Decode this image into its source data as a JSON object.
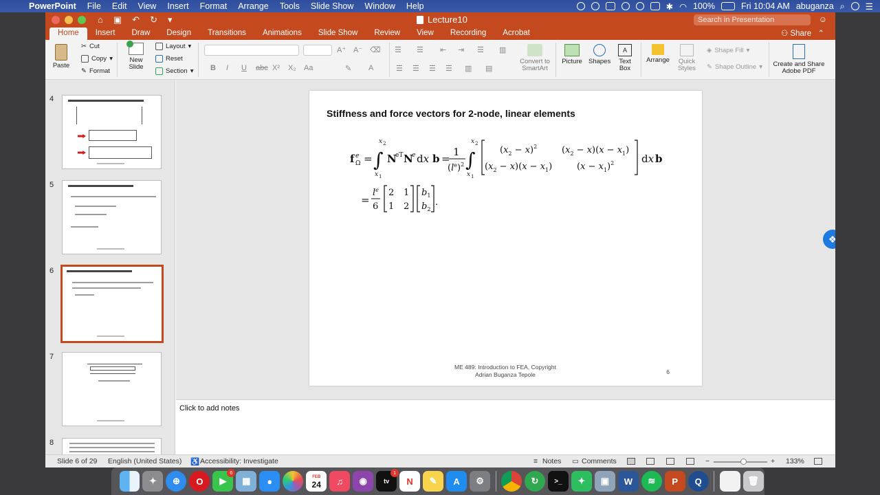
{
  "menubar": {
    "app": "PowerPoint",
    "items": [
      "File",
      "Edit",
      "View",
      "Insert",
      "Format",
      "Arrange",
      "Tools",
      "Slide Show",
      "Window",
      "Help"
    ],
    "battery": "100%",
    "clock": "Fri 10:04 AM",
    "user": "abuganza"
  },
  "window": {
    "title": "Lecture10",
    "search_placeholder": "Search in Presentation"
  },
  "tabs": [
    "Home",
    "Insert",
    "Draw",
    "Design",
    "Transitions",
    "Animations",
    "Slide Show",
    "Review",
    "View",
    "Recording",
    "Acrobat"
  ],
  "share_label": "Share",
  "ribbon": {
    "paste": "Paste",
    "cut": "Cut",
    "copy": "Copy",
    "format": "Format",
    "new_slide_1": "New",
    "new_slide_2": "Slide",
    "layout": "Layout",
    "reset": "Reset",
    "section": "Section",
    "convert_1": "Convert to",
    "convert_2": "SmartArt",
    "picture": "Picture",
    "shapes": "Shapes",
    "textbox_1": "Text",
    "textbox_2": "Box",
    "arrange": "Arrange",
    "quick_1": "Quick",
    "quick_2": "Styles",
    "shape_fill": "Shape Fill",
    "shape_outline": "Shape Outline",
    "adobe_1": "Create and Share",
    "adobe_2": "Adobe PDF"
  },
  "thumbnails": [
    {
      "num": "4",
      "title": "Plug into the weak form leads to the stiffness matrix and force vectors"
    },
    {
      "num": "5",
      "title": "Stiffness and force vectors for 2-node, linear elements"
    },
    {
      "num": "6",
      "title": "Stiffness and force vectors for 2-node, linear elements"
    },
    {
      "num": "7",
      "title": "Figure 5.23   A bar under compression."
    },
    {
      "num": "8",
      "title": "Consider a bar with uniformly distributed heat source"
    }
  ],
  "slide": {
    "title": "Stiffness and force vectors for 2-node, linear elements",
    "footer_1": "ME 489: Introduction to FEA, Copyright",
    "footer_2": "Adrian Buganza Tepole",
    "number": "6"
  },
  "notes_placeholder": "Click to add notes",
  "status": {
    "slide_count": "Slide 6 of 29",
    "language": "English (United States)",
    "accessibility": "Accessibility: Investigate",
    "notes": "Notes",
    "comments": "Comments",
    "zoom": "133%",
    "zoom_level": 0.55
  },
  "dock": {
    "calendar_month": "FEB",
    "calendar_day": "24",
    "facetime_badge": "6",
    "appletv_badge": "1"
  }
}
